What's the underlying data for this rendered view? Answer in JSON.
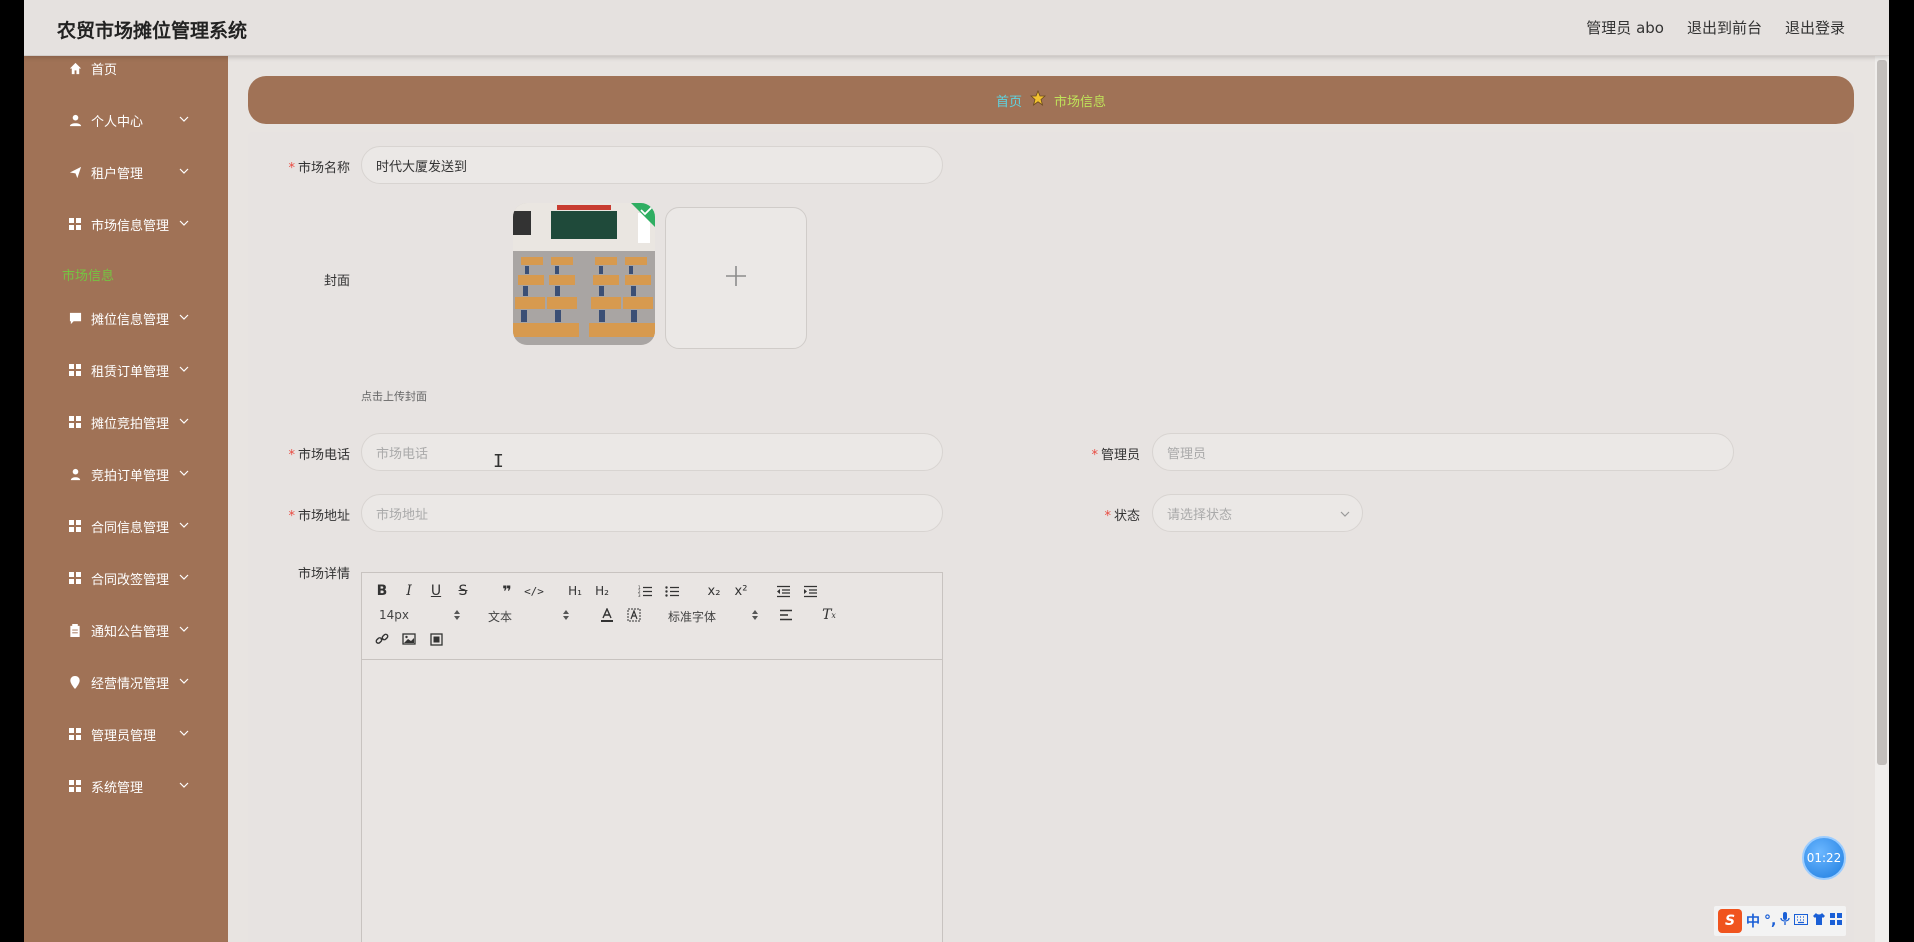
{
  "app": {
    "title": "农贸市场摊位管理系统"
  },
  "header": {
    "admin_label": "管理员 abo",
    "frontend_link": "退出到前台",
    "logout_link": "退出登录"
  },
  "sidebar": {
    "items": [
      {
        "label": "首页",
        "icon": "home-icon"
      },
      {
        "label": "个人中心",
        "icon": "user-icon"
      },
      {
        "label": "租户管理",
        "icon": "paper-plane-icon"
      },
      {
        "label": "市场信息管理",
        "icon": "grid-icon"
      },
      {
        "label": "摊位信息管理",
        "icon": "message-icon"
      },
      {
        "label": "租赁订单管理",
        "icon": "grid-icon"
      },
      {
        "label": "摊位竞拍管理",
        "icon": "grid-icon"
      },
      {
        "label": "竞拍订单管理",
        "icon": "user-tie-icon"
      },
      {
        "label": "合同信息管理",
        "icon": "grid-icon"
      },
      {
        "label": "合同改签管理",
        "icon": "grid-icon"
      },
      {
        "label": "通知公告管理",
        "icon": "clipboard-icon"
      },
      {
        "label": "经营情况管理",
        "icon": "location-icon"
      },
      {
        "label": "管理员管理",
        "icon": "grid-icon"
      },
      {
        "label": "系统管理",
        "icon": "grid-icon"
      }
    ],
    "active_sub": "市场信息"
  },
  "breadcrumb": {
    "home": "首页",
    "current": "市场信息"
  },
  "form": {
    "market_name_label": "市场名称",
    "market_name_value": "时代大厦发送到",
    "cover_label": "封面",
    "cover_hint": "点击上传封面",
    "phone_label": "市场电话",
    "phone_placeholder": "市场电话",
    "manager_label": "管理员",
    "manager_placeholder": "管理员",
    "address_label": "市场地址",
    "address_placeholder": "市场地址",
    "status_label": "状态",
    "status_placeholder": "请选择状态",
    "detail_label": "市场详情"
  },
  "editor": {
    "font_size": "14px",
    "text_style": "文本",
    "font_family": "标准字体"
  },
  "timer": "01:22",
  "ime": {
    "lang": "中"
  },
  "colors": {
    "sidebar": "#a07256",
    "active_sub": "#76c442",
    "breadcrumb_home": "#5fd3e0",
    "breadcrumb_current": "#bfe35a",
    "required": "#e8493f"
  }
}
